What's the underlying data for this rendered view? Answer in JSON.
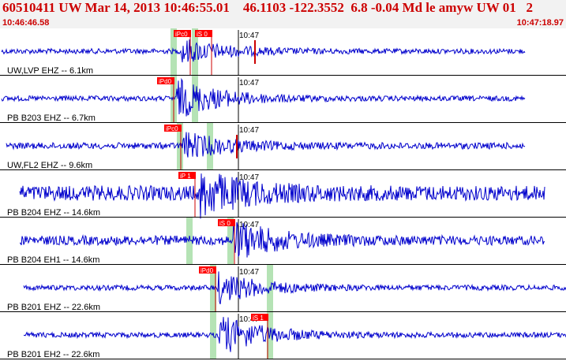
{
  "header": {
    "title": "60510411 UW Mar 14, 2013 10:46:55.01    46.1103 -122.3552  6.8 -0.04 Md le amyw UW 01   2",
    "start_time": "10:46:46.58",
    "end_time": "10:47:18.97"
  },
  "colors": {
    "trace": "#0000cc",
    "pick_box": "#ff0000",
    "pick_line": "#cc0000",
    "window": "#b5e3b5",
    "header_text": "#cc0000",
    "header_bg": "#f2f2f2"
  },
  "panels": [
    {
      "label": "UW,LVP EHZ -- 6.1km",
      "time_mark": "10:47",
      "trace_start": 2,
      "trace_end": 665,
      "onset": 230,
      "amp": 0.12,
      "burst": 0.55,
      "green": [
        220,
        247
      ],
      "picks": [
        {
          "text": "iPc0",
          "at": 220
        },
        {
          "text": "iS 0",
          "at": 247
        }
      ],
      "extra_lines": [
        323
      ]
    },
    {
      "label": "PB B203 EHZ -- 6.7km",
      "time_mark": "10:47",
      "trace_start": 2,
      "trace_end": 665,
      "onset": 224,
      "amp": 0.12,
      "burst": 0.9,
      "green": [
        220,
        247
      ],
      "picks": [
        {
          "text": "iPd0",
          "at": 199
        }
      ],
      "extra_lines": []
    },
    {
      "label": "UW,FL2 EHZ -- 9.6km",
      "time_mark": "10:47",
      "trace_start": 8,
      "trace_end": 665,
      "onset": 232,
      "amp": 0.15,
      "burst": 0.6,
      "green": [
        228,
        266
      ],
      "picks": [
        {
          "text": "iPc0",
          "at": 208
        }
      ],
      "extra_lines": [
        300
      ]
    },
    {
      "label": "PB B204 EHZ -- 14.6km",
      "time_mark": "10:47",
      "trace_start": 25,
      "trace_end": 690,
      "onset": 254,
      "amp": 0.35,
      "burst": 0.95,
      "green": [],
      "picks": [
        {
          "text": "iP 1",
          "at": 226
        }
      ],
      "extra_lines": []
    },
    {
      "label": "PB B204 EH1 -- 14.6km",
      "time_mark": "10:47",
      "trace_start": 25,
      "trace_end": 690,
      "onset": 296,
      "amp": 0.22,
      "burst": 0.85,
      "green": [
        240,
        292
      ],
      "picks": [
        {
          "text": "iS 0",
          "at": 276
        }
      ],
      "extra_lines": []
    },
    {
      "label": "PB B201 EHZ -- 22.6km",
      "time_mark": "10:47",
      "trace_start": 30,
      "trace_end": 717,
      "onset": 276,
      "amp": 0.12,
      "burst": 0.7,
      "green": [
        270,
        342
      ],
      "picks": [
        {
          "text": "iPd0",
          "at": 252
        }
      ],
      "extra_lines": []
    },
    {
      "label": "PB B201 EH2 -- 22.6km",
      "time_mark": "10:47",
      "trace_start": 30,
      "trace_end": 717,
      "onset": 277,
      "amp": 0.12,
      "burst": 0.9,
      "green": [
        270,
        342
      ],
      "picks": [
        {
          "text": "iS 1",
          "at": 318
        }
      ],
      "extra_lines": []
    }
  ]
}
